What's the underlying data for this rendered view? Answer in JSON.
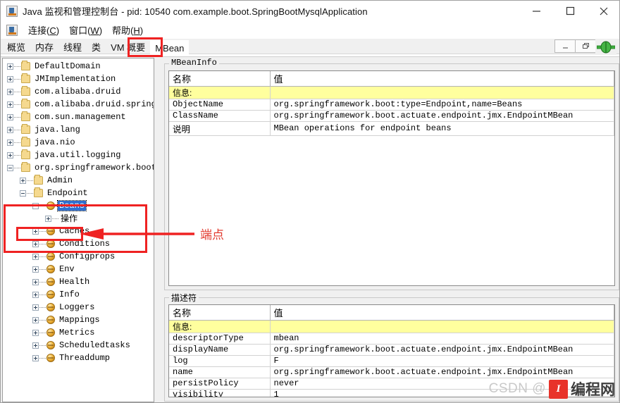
{
  "window": {
    "title": "Java 监视和管理控制台 - pid: 10540 com.example.boot.SpringBootMysqlApplication",
    "app_icon": "java-cup-icon",
    "minimize_label": "—",
    "maximize_label": "□",
    "close_label": "✕"
  },
  "menubar": {
    "icon": "java-cup-icon",
    "items": [
      {
        "label": "连接(C)",
        "text": "连接",
        "mnemonic": "C"
      },
      {
        "label": "窗口(W)",
        "text": "窗口",
        "mnemonic": "W"
      },
      {
        "label": "帮助(H)",
        "text": "帮助",
        "mnemonic": "H"
      }
    ]
  },
  "mdi_controls": {
    "minimize": "_",
    "restore": "❐",
    "close": "✕"
  },
  "tabs": {
    "items": [
      {
        "label": "概览",
        "active": false
      },
      {
        "label": "内存",
        "active": false
      },
      {
        "label": "线程",
        "active": false
      },
      {
        "label": "类",
        "active": false
      },
      {
        "label": "VM 概要",
        "active": false
      },
      {
        "label": "MBean",
        "active": true
      }
    ]
  },
  "connection_indicator": {
    "icon": "green-connected-icon",
    "color": "#2f9e2f"
  },
  "tree": {
    "nodes": [
      {
        "label": "DefaultDomain",
        "depth": 0,
        "toggle": "plus",
        "icon": "folder",
        "selected": false
      },
      {
        "label": "JMImplementation",
        "depth": 0,
        "toggle": "plus",
        "icon": "folder",
        "selected": false
      },
      {
        "label": "com.alibaba.druid",
        "depth": 0,
        "toggle": "plus",
        "icon": "folder",
        "selected": false
      },
      {
        "label": "com.alibaba.druid.spring.boot.s",
        "depth": 0,
        "toggle": "plus",
        "icon": "folder",
        "selected": false
      },
      {
        "label": "com.sun.management",
        "depth": 0,
        "toggle": "plus",
        "icon": "folder",
        "selected": false
      },
      {
        "label": "java.lang",
        "depth": 0,
        "toggle": "plus",
        "icon": "folder",
        "selected": false
      },
      {
        "label": "java.nio",
        "depth": 0,
        "toggle": "plus",
        "icon": "folder",
        "selected": false
      },
      {
        "label": "java.util.logging",
        "depth": 0,
        "toggle": "plus",
        "icon": "folder",
        "selected": false
      },
      {
        "label": "org.springframework.boot",
        "depth": 0,
        "toggle": "minus",
        "icon": "folder",
        "selected": false
      },
      {
        "label": "Admin",
        "depth": 1,
        "toggle": "plus",
        "icon": "folder",
        "selected": false
      },
      {
        "label": "Endpoint",
        "depth": 1,
        "toggle": "minus",
        "icon": "folder",
        "selected": false
      },
      {
        "label": "Beans",
        "depth": 2,
        "toggle": "minus",
        "icon": "mbean",
        "selected": true
      },
      {
        "label": "操作",
        "depth": 3,
        "toggle": "plus",
        "icon": "none",
        "selected": false,
        "cjk": true
      },
      {
        "label": "Caches",
        "depth": 2,
        "toggle": "plus",
        "icon": "mbean",
        "selected": false
      },
      {
        "label": "Conditions",
        "depth": 2,
        "toggle": "plus",
        "icon": "mbean",
        "selected": false
      },
      {
        "label": "Configprops",
        "depth": 2,
        "toggle": "plus",
        "icon": "mbean",
        "selected": false
      },
      {
        "label": "Env",
        "depth": 2,
        "toggle": "plus",
        "icon": "mbean",
        "selected": false
      },
      {
        "label": "Health",
        "depth": 2,
        "toggle": "plus",
        "icon": "mbean",
        "selected": false
      },
      {
        "label": "Info",
        "depth": 2,
        "toggle": "plus",
        "icon": "mbean",
        "selected": false
      },
      {
        "label": "Loggers",
        "depth": 2,
        "toggle": "plus",
        "icon": "mbean",
        "selected": false
      },
      {
        "label": "Mappings",
        "depth": 2,
        "toggle": "plus",
        "icon": "mbean",
        "selected": false
      },
      {
        "label": "Metrics",
        "depth": 2,
        "toggle": "plus",
        "icon": "mbean",
        "selected": false
      },
      {
        "label": "Scheduledtasks",
        "depth": 2,
        "toggle": "plus",
        "icon": "mbean",
        "selected": false
      },
      {
        "label": "Threaddump",
        "depth": 2,
        "toggle": "plus",
        "icon": "mbean",
        "selected": false
      }
    ]
  },
  "annotations": {
    "color": "#ef2222",
    "label": "端点",
    "arrow": "left-arrow"
  },
  "mbean_info": {
    "title": "MBeanInfo",
    "columns": [
      "名称",
      "值"
    ],
    "rows": [
      {
        "name": "信息:",
        "value": "",
        "highlight": true
      },
      {
        "name": "ObjectName",
        "value": "org.springframework.boot:type=Endpoint,name=Beans",
        "highlight": false
      },
      {
        "name": "ClassName",
        "value": "org.springframework.boot.actuate.endpoint.jmx.EndpointMBean",
        "highlight": false
      },
      {
        "name": "说明",
        "value": "MBean operations for endpoint beans",
        "highlight": false,
        "cjk": true
      }
    ]
  },
  "descriptor": {
    "title": "描述符",
    "columns": [
      "名称",
      "值"
    ],
    "rows": [
      {
        "name": "信息:",
        "value": "",
        "highlight": true
      },
      {
        "name": "descriptorType",
        "value": "mbean",
        "highlight": false
      },
      {
        "name": "displayName",
        "value": "org.springframework.boot.actuate.endpoint.jmx.EndpointMBean",
        "highlight": false
      },
      {
        "name": "log",
        "value": "F",
        "highlight": false
      },
      {
        "name": "name",
        "value": "org.springframework.boot.actuate.endpoint.jmx.EndpointMBean",
        "highlight": false
      },
      {
        "name": "persistPolicy",
        "value": "never",
        "highlight": false
      },
      {
        "name": "visibility",
        "value": "1",
        "highlight": false
      }
    ]
  },
  "watermark": {
    "prefix": "CSDN @",
    "logo_text": "I",
    "brand": "编程网"
  }
}
